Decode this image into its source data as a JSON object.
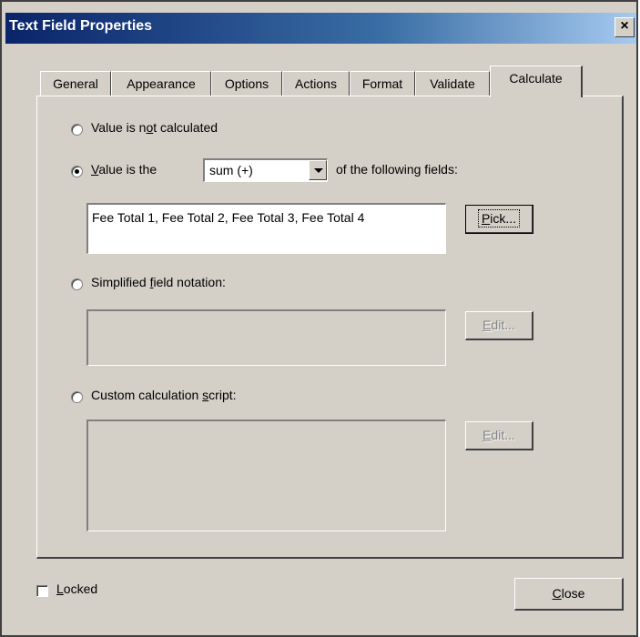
{
  "window": {
    "title": "Text Field Properties",
    "close_glyph": "×"
  },
  "tabs": [
    {
      "label": "General",
      "active": false
    },
    {
      "label": "Appearance",
      "active": false
    },
    {
      "label": "Options",
      "active": false
    },
    {
      "label": "Actions",
      "active": false
    },
    {
      "label": "Format",
      "active": false
    },
    {
      "label": "Validate",
      "active": false
    },
    {
      "label": "Calculate",
      "active": true
    }
  ],
  "calculate": {
    "opt_not_calculated": {
      "pre": "Value is n",
      "key": "o",
      "post": "t calculated",
      "selected": false
    },
    "opt_value_is": {
      "pre": "",
      "key": "V",
      "post": "alue is the",
      "selected": true
    },
    "operation_select": {
      "value": "sum (+)"
    },
    "following_fields_label": "of the following fields:",
    "fields_value": "Fee Total 1, Fee Total 2, Fee Total 3, Fee Total 4",
    "pick_button": {
      "key": "P",
      "post": "ick..."
    },
    "opt_simplified": {
      "pre": "Simplified ",
      "key": "f",
      "post": "ield notation:",
      "selected": false
    },
    "simplified_edit_button": {
      "key": "E",
      "post": "dit..."
    },
    "opt_custom": {
      "pre": "Custom calculation ",
      "key": "s",
      "post": "cript:",
      "selected": false
    },
    "custom_edit_button": {
      "key": "E",
      "post": "dit..."
    }
  },
  "footer": {
    "locked": {
      "key": "L",
      "post": "ocked",
      "checked": false
    },
    "close_button": {
      "key": "C",
      "post": "lose"
    }
  },
  "colors": {
    "face": "#d4d0c8",
    "title_start": "#0a246a",
    "title_end": "#a6caf0"
  }
}
